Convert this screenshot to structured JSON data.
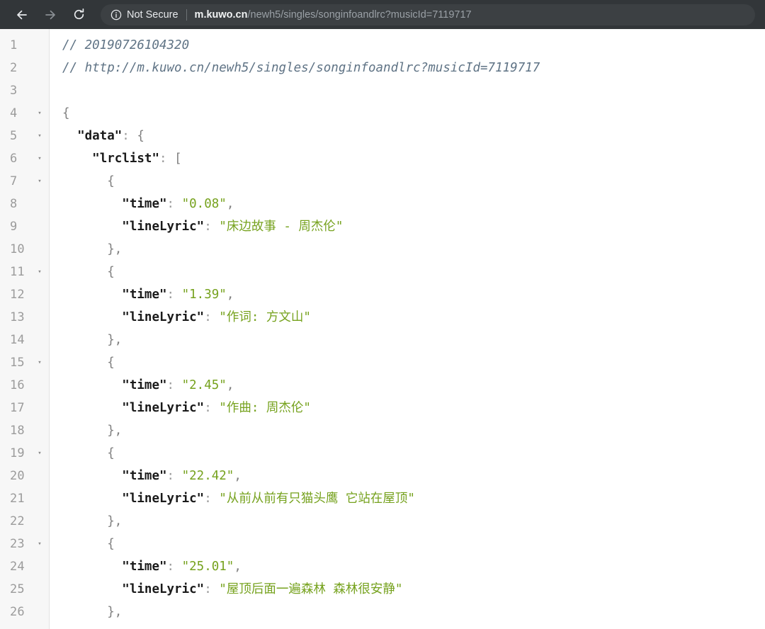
{
  "browser": {
    "back_label": "Back",
    "forward_label": "Forward",
    "reload_label": "Reload this page",
    "security_text": "Not Secure",
    "security_icon": "info-circle-icon",
    "url_domain": "m.kuwo.cn",
    "url_path": "/newh5/singles/songinfoandlrc?musicId=7119717",
    "url_full": "m.kuwo.cn/newh5/singles/songinfoandlrc?musicId=7119717",
    "toolbar_bg": "#323639",
    "omnibox_bg": "#3c4043"
  },
  "viewer": {
    "gutter_bg": "#f7f7f7",
    "content_bg": "#ffffff",
    "fold_glyph": "▾",
    "colors": {
      "comment": "#5f7385",
      "key": "#1a1a1a",
      "string": "#76a21e",
      "punctuation": "#808080",
      "line_number": "#9b9b9b"
    }
  },
  "lines": [
    {
      "n": 1,
      "fold": false,
      "tokens": [
        {
          "t": "comment",
          "v": "// 20190726104320"
        }
      ]
    },
    {
      "n": 2,
      "fold": false,
      "tokens": [
        {
          "t": "comment",
          "v": "// http://m.kuwo.cn/newh5/singles/songinfoandlrc?musicId=7119717"
        }
      ]
    },
    {
      "n": 3,
      "fold": false,
      "tokens": []
    },
    {
      "n": 4,
      "fold": true,
      "tokens": [
        {
          "t": "brace",
          "v": "{"
        }
      ]
    },
    {
      "n": 5,
      "fold": true,
      "tokens": [
        {
          "t": "plain",
          "v": "  "
        },
        {
          "t": "key",
          "v": "\"data\""
        },
        {
          "t": "colon",
          "v": ": "
        },
        {
          "t": "brace",
          "v": "{"
        }
      ]
    },
    {
      "n": 6,
      "fold": true,
      "tokens": [
        {
          "t": "plain",
          "v": "    "
        },
        {
          "t": "key",
          "v": "\"lrclist\""
        },
        {
          "t": "colon",
          "v": ": "
        },
        {
          "t": "brace",
          "v": "["
        }
      ]
    },
    {
      "n": 7,
      "fold": true,
      "tokens": [
        {
          "t": "plain",
          "v": "      "
        },
        {
          "t": "brace",
          "v": "{"
        }
      ]
    },
    {
      "n": 8,
      "fold": false,
      "tokens": [
        {
          "t": "plain",
          "v": "        "
        },
        {
          "t": "key",
          "v": "\"time\""
        },
        {
          "t": "colon",
          "v": ": "
        },
        {
          "t": "string",
          "v": "\"0.08\""
        },
        {
          "t": "punc",
          "v": ","
        }
      ]
    },
    {
      "n": 9,
      "fold": false,
      "tokens": [
        {
          "t": "plain",
          "v": "        "
        },
        {
          "t": "key",
          "v": "\"lineLyric\""
        },
        {
          "t": "colon",
          "v": ": "
        },
        {
          "t": "string",
          "v": "\"床边故事 - 周杰伦\""
        }
      ]
    },
    {
      "n": 10,
      "fold": false,
      "tokens": [
        {
          "t": "plain",
          "v": "      "
        },
        {
          "t": "brace",
          "v": "}"
        },
        {
          "t": "punc",
          "v": ","
        }
      ]
    },
    {
      "n": 11,
      "fold": true,
      "tokens": [
        {
          "t": "plain",
          "v": "      "
        },
        {
          "t": "brace",
          "v": "{"
        }
      ]
    },
    {
      "n": 12,
      "fold": false,
      "tokens": [
        {
          "t": "plain",
          "v": "        "
        },
        {
          "t": "key",
          "v": "\"time\""
        },
        {
          "t": "colon",
          "v": ": "
        },
        {
          "t": "string",
          "v": "\"1.39\""
        },
        {
          "t": "punc",
          "v": ","
        }
      ]
    },
    {
      "n": 13,
      "fold": false,
      "tokens": [
        {
          "t": "plain",
          "v": "        "
        },
        {
          "t": "key",
          "v": "\"lineLyric\""
        },
        {
          "t": "colon",
          "v": ": "
        },
        {
          "t": "string",
          "v": "\"作词: 方文山\""
        }
      ]
    },
    {
      "n": 14,
      "fold": false,
      "tokens": [
        {
          "t": "plain",
          "v": "      "
        },
        {
          "t": "brace",
          "v": "}"
        },
        {
          "t": "punc",
          "v": ","
        }
      ]
    },
    {
      "n": 15,
      "fold": true,
      "tokens": [
        {
          "t": "plain",
          "v": "      "
        },
        {
          "t": "brace",
          "v": "{"
        }
      ]
    },
    {
      "n": 16,
      "fold": false,
      "tokens": [
        {
          "t": "plain",
          "v": "        "
        },
        {
          "t": "key",
          "v": "\"time\""
        },
        {
          "t": "colon",
          "v": ": "
        },
        {
          "t": "string",
          "v": "\"2.45\""
        },
        {
          "t": "punc",
          "v": ","
        }
      ]
    },
    {
      "n": 17,
      "fold": false,
      "tokens": [
        {
          "t": "plain",
          "v": "        "
        },
        {
          "t": "key",
          "v": "\"lineLyric\""
        },
        {
          "t": "colon",
          "v": ": "
        },
        {
          "t": "string",
          "v": "\"作曲: 周杰伦\""
        }
      ]
    },
    {
      "n": 18,
      "fold": false,
      "tokens": [
        {
          "t": "plain",
          "v": "      "
        },
        {
          "t": "brace",
          "v": "}"
        },
        {
          "t": "punc",
          "v": ","
        }
      ]
    },
    {
      "n": 19,
      "fold": true,
      "tokens": [
        {
          "t": "plain",
          "v": "      "
        },
        {
          "t": "brace",
          "v": "{"
        }
      ]
    },
    {
      "n": 20,
      "fold": false,
      "tokens": [
        {
          "t": "plain",
          "v": "        "
        },
        {
          "t": "key",
          "v": "\"time\""
        },
        {
          "t": "colon",
          "v": ": "
        },
        {
          "t": "string",
          "v": "\"22.42\""
        },
        {
          "t": "punc",
          "v": ","
        }
      ]
    },
    {
      "n": 21,
      "fold": false,
      "tokens": [
        {
          "t": "plain",
          "v": "        "
        },
        {
          "t": "key",
          "v": "\"lineLyric\""
        },
        {
          "t": "colon",
          "v": ": "
        },
        {
          "t": "string",
          "v": "\"从前从前有只猫头鹰 它站在屋顶\""
        }
      ]
    },
    {
      "n": 22,
      "fold": false,
      "tokens": [
        {
          "t": "plain",
          "v": "      "
        },
        {
          "t": "brace",
          "v": "}"
        },
        {
          "t": "punc",
          "v": ","
        }
      ]
    },
    {
      "n": 23,
      "fold": true,
      "tokens": [
        {
          "t": "plain",
          "v": "      "
        },
        {
          "t": "brace",
          "v": "{"
        }
      ]
    },
    {
      "n": 24,
      "fold": false,
      "tokens": [
        {
          "t": "plain",
          "v": "        "
        },
        {
          "t": "key",
          "v": "\"time\""
        },
        {
          "t": "colon",
          "v": ": "
        },
        {
          "t": "string",
          "v": "\"25.01\""
        },
        {
          "t": "punc",
          "v": ","
        }
      ]
    },
    {
      "n": 25,
      "fold": false,
      "tokens": [
        {
          "t": "plain",
          "v": "        "
        },
        {
          "t": "key",
          "v": "\"lineLyric\""
        },
        {
          "t": "colon",
          "v": ": "
        },
        {
          "t": "string",
          "v": "\"屋顶后面一遍森林 森林很安静\""
        }
      ]
    },
    {
      "n": 26,
      "fold": false,
      "tokens": [
        {
          "t": "plain",
          "v": "      "
        },
        {
          "t": "brace",
          "v": "}"
        },
        {
          "t": "punc",
          "v": ","
        }
      ]
    }
  ]
}
